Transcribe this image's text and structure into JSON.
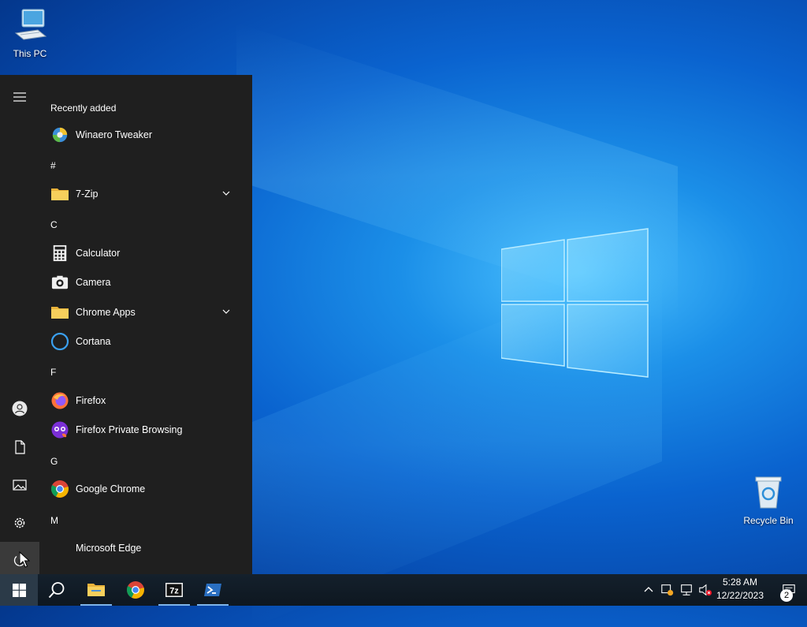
{
  "desktop": {
    "icons": [
      {
        "label": "This PC",
        "icon": "computer-icon"
      },
      {
        "label": "Recycle Bin",
        "icon": "recycle-bin-icon"
      }
    ]
  },
  "start_menu": {
    "rail": [
      "menu-icon",
      "user-icon",
      "document-icon",
      "pictures-icon",
      "settings-icon",
      "power-icon"
    ],
    "recently_added_label": "Recently added",
    "recent": [
      {
        "label": "Winaero Tweaker",
        "icon": "winaero-tweaker-icon"
      }
    ],
    "groups": [
      {
        "letter": "#",
        "apps": [
          {
            "label": "7-Zip",
            "icon": "folder-icon",
            "expandable": true
          }
        ]
      },
      {
        "letter": "C",
        "apps": [
          {
            "label": "Calculator",
            "icon": "calculator-icon"
          },
          {
            "label": "Camera",
            "icon": "camera-icon"
          },
          {
            "label": "Chrome Apps",
            "icon": "folder-icon",
            "expandable": true
          },
          {
            "label": "Cortana",
            "icon": "cortana-icon"
          }
        ]
      },
      {
        "letter": "F",
        "apps": [
          {
            "label": "Firefox",
            "icon": "firefox-icon"
          },
          {
            "label": "Firefox Private Browsing",
            "icon": "firefox-private-icon"
          }
        ]
      },
      {
        "letter": "G",
        "apps": [
          {
            "label": "Google Chrome",
            "icon": "chrome-icon"
          }
        ]
      },
      {
        "letter": "M",
        "apps": [
          {
            "label": "Microsoft Edge",
            "icon": "edge-icon"
          }
        ]
      }
    ]
  },
  "taskbar": {
    "pinned": [
      "start-icon",
      "search-icon",
      "file-explorer-icon",
      "chrome-icon",
      "7zip-icon",
      "powershell-icon"
    ],
    "clock_time": "5:28 AM",
    "clock_date": "12/22/2023",
    "notification_count": "2"
  },
  "colors": {
    "start_menu_bg": "#1f1f1f",
    "taskbar_bg": "#101820",
    "wallpaper_blue": "#0a63cf"
  }
}
